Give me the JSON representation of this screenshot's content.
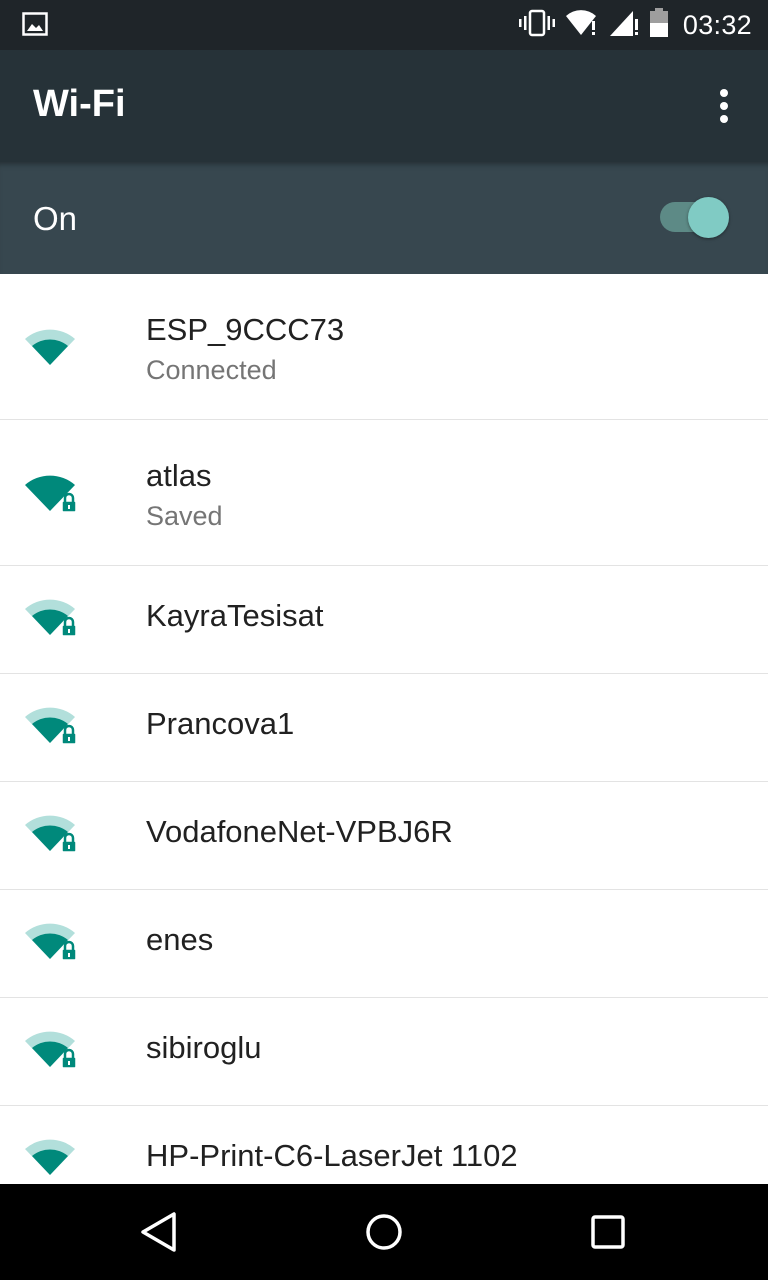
{
  "status_bar": {
    "time": "03:32",
    "icons": [
      "image-notification-icon",
      "vibrate-icon",
      "wifi-no-internet-icon",
      "cell-signal-icon",
      "battery-icon"
    ]
  },
  "app_bar": {
    "title": "Wi-Fi",
    "menu_icon": "more-vert-icon"
  },
  "wifi_switch": {
    "label": "On",
    "checked": true,
    "accent_color": "#80cbc4"
  },
  "networks": [
    {
      "ssid": "ESP_9CCC73",
      "status": "Connected",
      "secured": false,
      "signal": "medium"
    },
    {
      "ssid": "atlas",
      "status": "Saved",
      "secured": true,
      "signal": "full"
    },
    {
      "ssid": "KayraTesisat",
      "status": "",
      "secured": true,
      "signal": "medium"
    },
    {
      "ssid": "Prancova1",
      "status": "",
      "secured": true,
      "signal": "medium"
    },
    {
      "ssid": "VodafoneNet-VPBJ6R",
      "status": "",
      "secured": true,
      "signal": "medium"
    },
    {
      "ssid": "enes",
      "status": "",
      "secured": true,
      "signal": "medium"
    },
    {
      "ssid": "sibiroglu",
      "status": "",
      "secured": true,
      "signal": "medium"
    },
    {
      "ssid": "HP-Print-C6-LaserJet 1102",
      "status": "",
      "secured": false,
      "signal": "medium"
    }
  ],
  "colors": {
    "signal_dark": "#00897b",
    "signal_light": "#b2dfdb",
    "app_bar": "#263238",
    "switch_bar": "#37474f"
  },
  "nav_bar": {
    "buttons": [
      "back-icon",
      "home-icon",
      "recents-icon"
    ]
  }
}
